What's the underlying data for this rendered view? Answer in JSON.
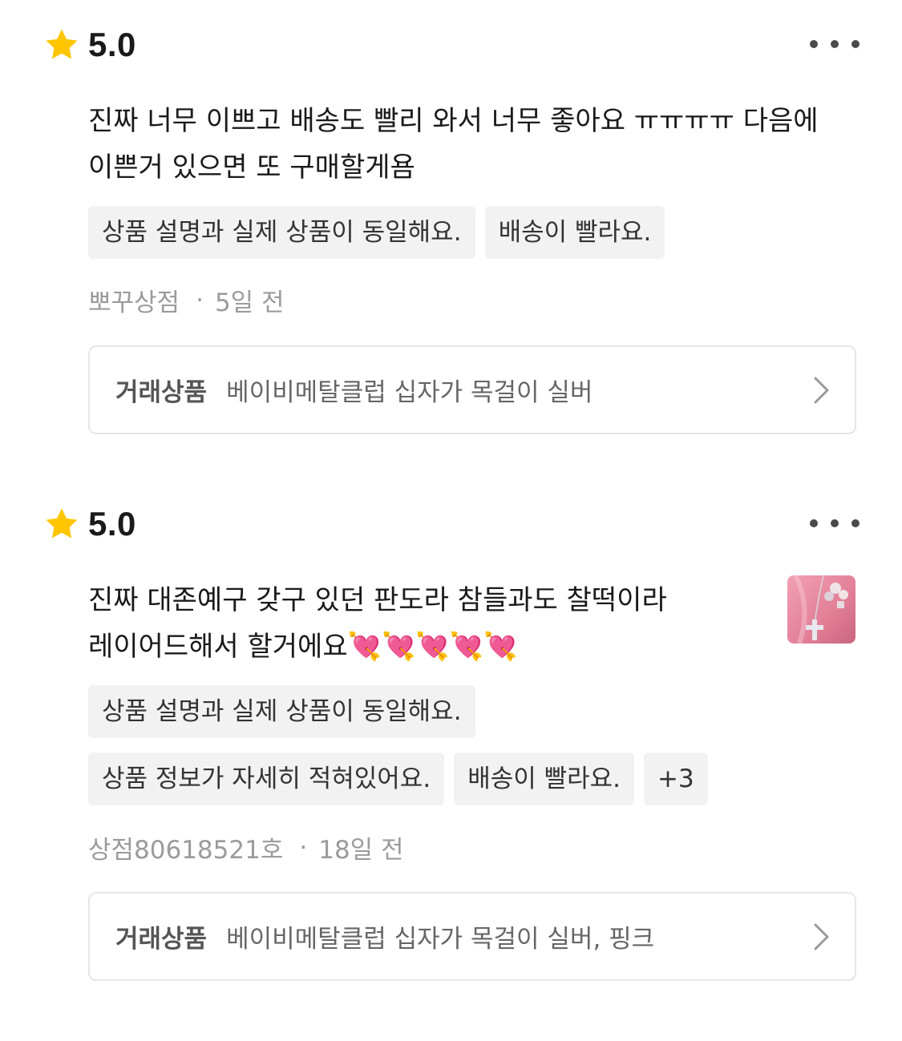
{
  "reviews": [
    {
      "rating": "5.0",
      "text": "진짜 너무 이쁘고 배송도 빨리 와서 너무 좋아요 ㅠㅠㅠㅠ 다음에 이쁜거 있으면 또 구매할게욤",
      "tag_rows": [
        [
          "상품 설명과 실제 상품이 동일해요.",
          "배송이 빨라요."
        ]
      ],
      "store": "뽀꾸상점",
      "separator": "·",
      "time": "5일 전",
      "trade_label": "거래상품",
      "trade_item": "베이비메탈클럽 십자가 목걸이 실버",
      "has_photo": false
    },
    {
      "rating": "5.0",
      "text": "진짜 대존예구 갖구 있던 판도라 참들과도 찰떡이라 레이어드해서 할거에요💘💘💘💘💘",
      "tag_rows": [
        [
          "상품 설명과 실제 상품이 동일해요."
        ],
        [
          "상품 정보가 자세히 적혀있어요.",
          "배송이 빨라요.",
          "+3"
        ]
      ],
      "store": "상점80618521호",
      "separator": "·",
      "time": "18일 전",
      "trade_label": "거래상품",
      "trade_item": "베이비메탈클럽 십자가 목걸이 실버, 핑크",
      "has_photo": true
    }
  ],
  "colors": {
    "star": "#FFC600",
    "tag_bg": "#F2F2F2",
    "meta_text": "#9B9B9B",
    "card_border": "#E6E6E6",
    "thumb_pink": "#E98AA0"
  },
  "icons": {
    "rating": "star-icon",
    "menu": "more-dots-icon",
    "card_arrow": "chevron-right-icon"
  }
}
